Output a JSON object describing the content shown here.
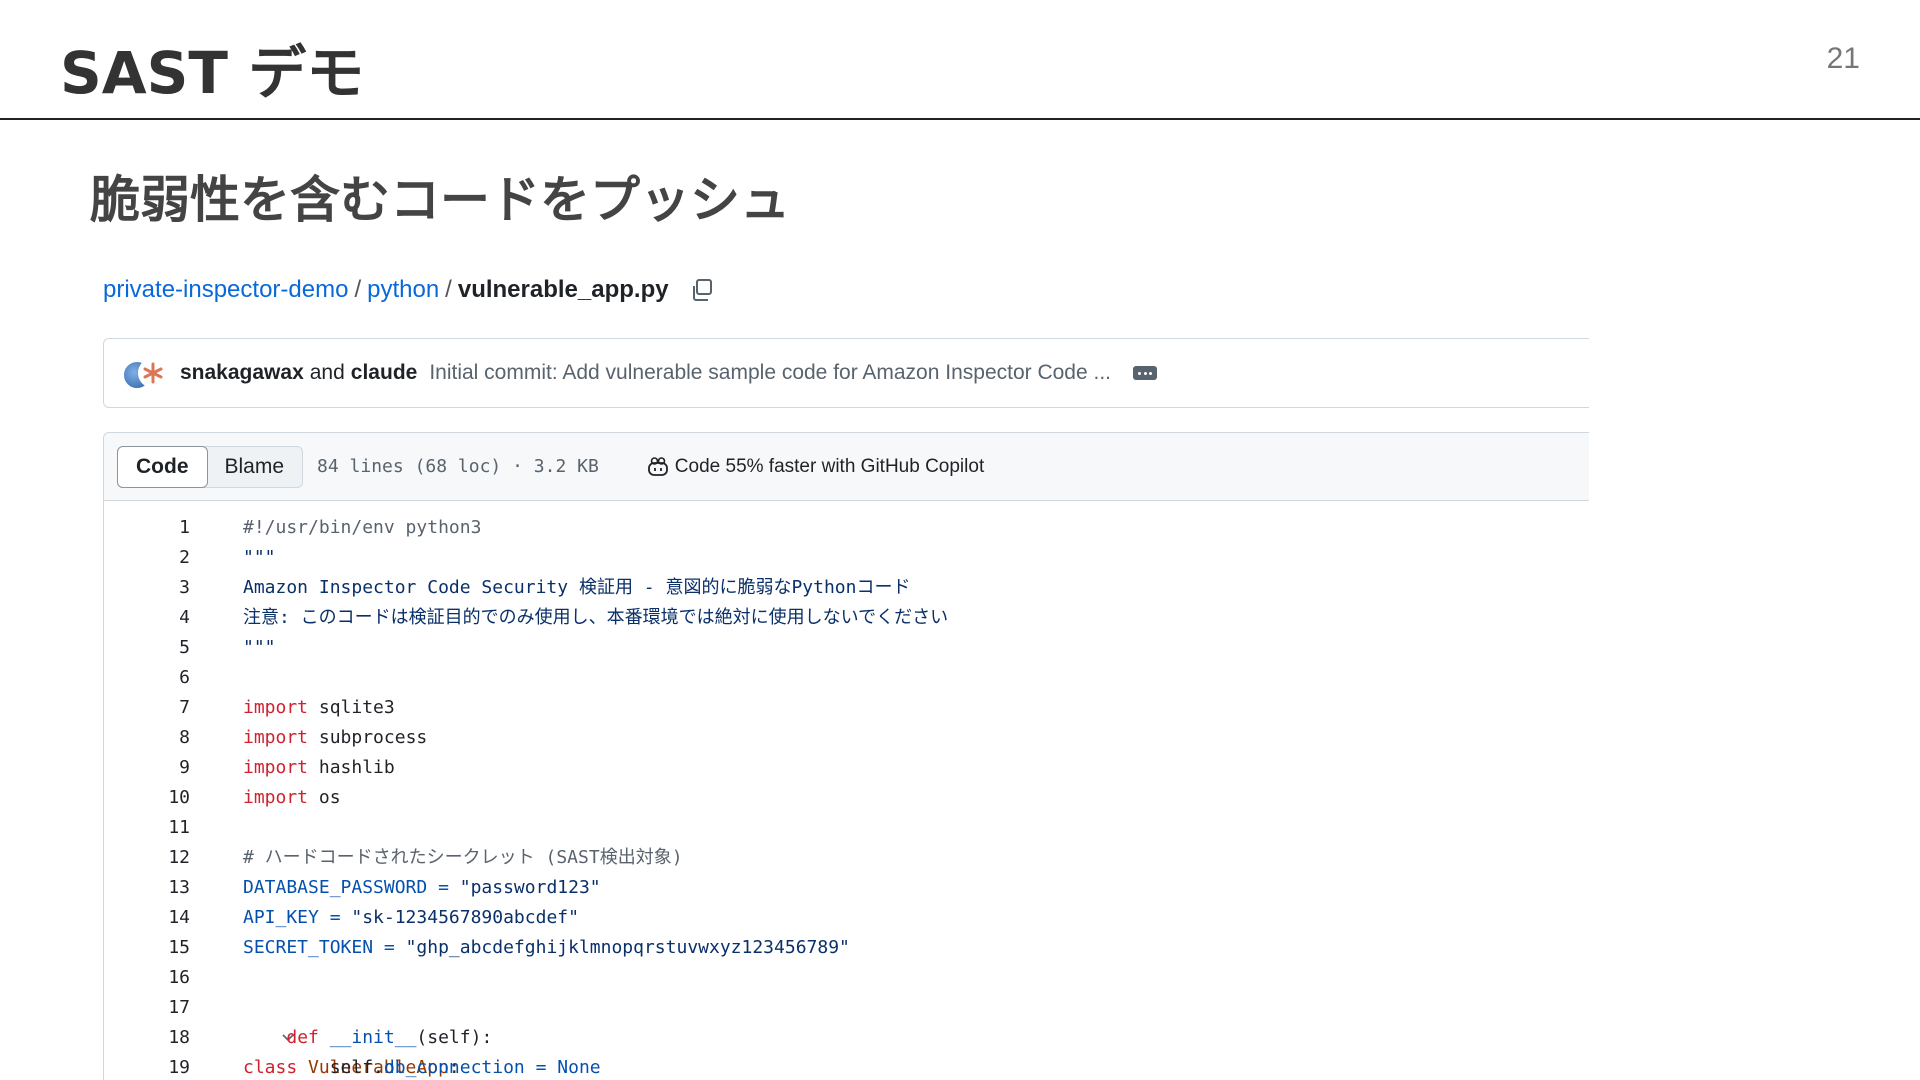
{
  "slide": {
    "title": "SAST デモ",
    "page_number": "21",
    "subtitle": "脆弱性を含むコードをプッシュ"
  },
  "breadcrumb": {
    "repo": "private-inspector-demo",
    "sep1": "/",
    "folder": "python",
    "sep2": "/",
    "file": "vulnerable_app.py"
  },
  "commit": {
    "author1": "snakagawax",
    "and": "and",
    "author2": "claude",
    "message": "Initial commit: Add vulnerable sample code for Amazon Inspector Code ..."
  },
  "file_toolbar": {
    "code_tab": "Code",
    "blame_tab": "Blame",
    "meta": "84 lines (68 loc) · 3.2 KB",
    "copilot": "Code 55% faster with GitHub Copilot"
  },
  "code_lines": [
    {
      "n": "1",
      "text": "#!/usr/bin/env python3"
    },
    {
      "n": "2",
      "text": "\"\"\""
    },
    {
      "n": "3",
      "text": "Amazon Inspector Code Security 検証用 - 意図的に脆弱なPythonコード"
    },
    {
      "n": "4",
      "text": "注意: このコードは検証目的でのみ使用し、本番環境では絶対に使用しないでください"
    },
    {
      "n": "5",
      "text": "\"\"\""
    },
    {
      "n": "6",
      "text": ""
    },
    {
      "n": "7",
      "kw": "import",
      "rest": " sqlite3"
    },
    {
      "n": "8",
      "kw": "import",
      "rest": " subprocess"
    },
    {
      "n": "9",
      "kw": "import",
      "rest": " hashlib"
    },
    {
      "n": "10",
      "kw": "import",
      "rest": " os"
    },
    {
      "n": "11",
      "text": ""
    },
    {
      "n": "12",
      "text": "# ハードコードされたシークレット (SAST検出対象)"
    },
    {
      "n": "13",
      "name": "DATABASE_PASSWORD",
      "eq": " = ",
      "val": "\"password123\""
    },
    {
      "n": "14",
      "name": "API_KEY",
      "eq": " = ",
      "val": "\"sk-1234567890abcdef\""
    },
    {
      "n": "15",
      "name": "SECRET_TOKEN",
      "eq": " = ",
      "val": "\"ghp_abcdefghijklmnopqrstuvwxyz123456789\""
    },
    {
      "n": "16",
      "text": ""
    },
    {
      "n": "17",
      "kw": "class",
      "cls": " VulnerableApp",
      "rest": ":"
    },
    {
      "n": "18",
      "indent": "    ",
      "kw": "def",
      "fn": " __init__",
      "rest": "(self):"
    },
    {
      "n": "19",
      "indent": "        ",
      "pre": "self.",
      "attr": "db_connection",
      "eq": " = ",
      "none": "None"
    }
  ],
  "colors": {
    "link": "#0969da",
    "keyword": "#cf222e",
    "string": "#0a3069",
    "constant": "#0550ae",
    "class_name": "#953800"
  }
}
